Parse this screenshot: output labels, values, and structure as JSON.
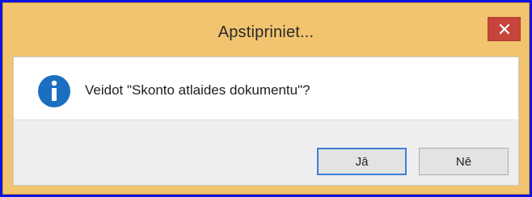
{
  "window": {
    "title": "Apstipriniet...",
    "close_label": "✕"
  },
  "message": {
    "icon": "info-icon",
    "text": "Veidot \"Skonto atlaides dokumentu\"?"
  },
  "buttons": {
    "yes_label": "Jā",
    "no_label": "Nē"
  },
  "colors": {
    "frame_border": "#0b14e0",
    "title_bar": "#f2c46f",
    "close_button": "#c7443b",
    "info_icon": "#1a6fc1",
    "default_button_border": "#3c7fd8"
  }
}
